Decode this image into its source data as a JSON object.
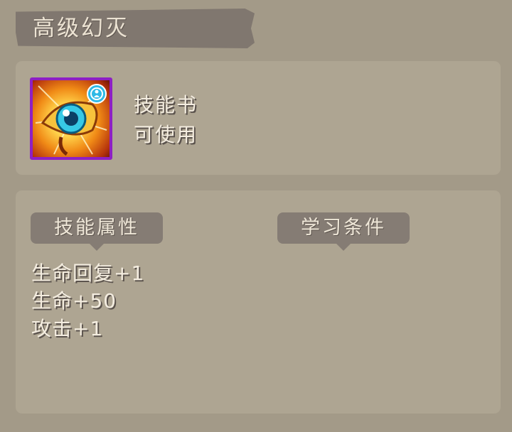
{
  "item": {
    "name": "高级幻灭",
    "type": "技能书",
    "status": "可使用",
    "icon": "glowing-eye-skill-icon",
    "badge_icon": "bound-person-badge-icon",
    "border_color": "#8e1fc4"
  },
  "sections": {
    "attributes_label": "技能属性",
    "requirements_label": "学习条件"
  },
  "attributes": [
    "生命回复+1",
    "生命+50",
    "攻击+1"
  ],
  "requirements": []
}
